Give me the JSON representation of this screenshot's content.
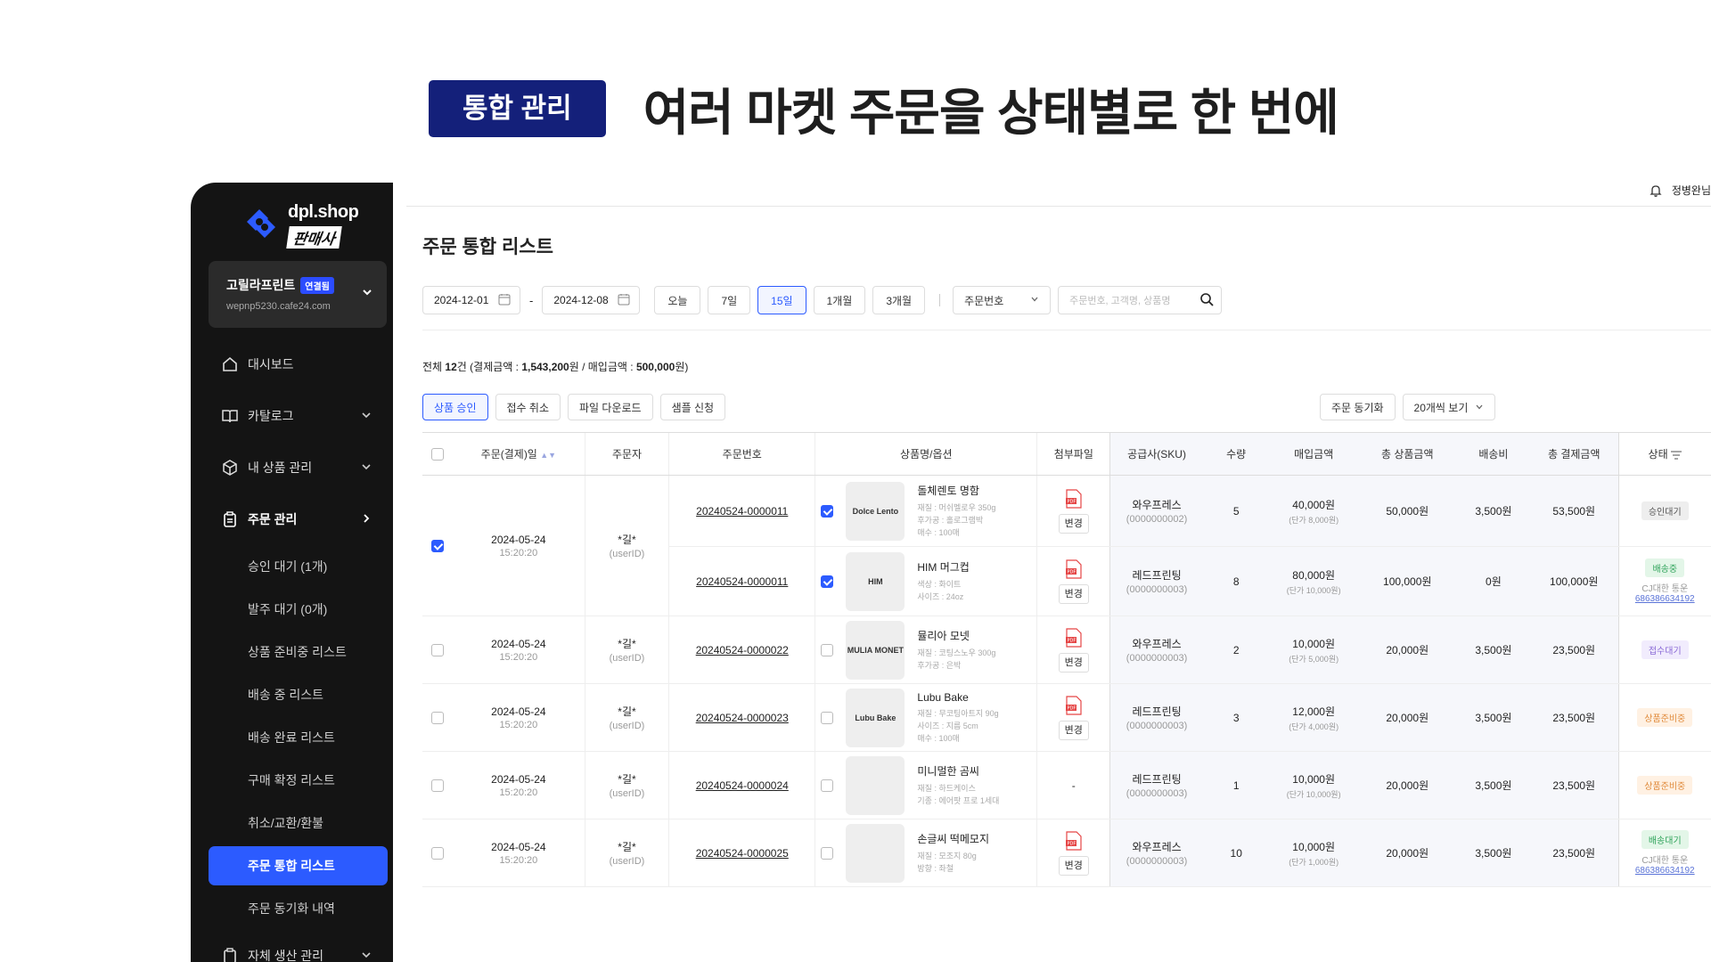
{
  "hero": {
    "badge": "통합 관리",
    "title": "여러 마켓 주문을 상태별로 한 번에"
  },
  "brand": {
    "name": "dpl.shop",
    "sub": "판매사"
  },
  "account": {
    "name": "고릴라프린트",
    "badge": "연결됨",
    "url": "wepnp5230.cafe24.com"
  },
  "nav": {
    "dashboard": "대시보드",
    "catalog": "카탈로그",
    "my_products": "내 상품 관리",
    "orders": "주문 관리",
    "sub": [
      "승인 대기 (1개)",
      "발주 대기 (0개)",
      "상품 준비중 리스트",
      "배송 중 리스트",
      "배송 완료 리스트",
      "구매 확정 리스트",
      "취소/교환/환불",
      "주문 통합 리스트",
      "주문 동기화 내역"
    ],
    "self_production": "자체 생산 관리"
  },
  "topbar": {
    "user": "정병완님"
  },
  "page": {
    "title": "주문 통합 리스트"
  },
  "filters": {
    "start_date": "2024-12-01",
    "end_date": "2024-12-08",
    "dash": "-",
    "periods": [
      "오늘",
      "7일",
      "15일",
      "1개월",
      "3개월"
    ],
    "selected_period": "15일",
    "search_type": "주문번호",
    "search_placeholder": "주문번호, 고객명, 상품명"
  },
  "summary": {
    "prefix": "전체 ",
    "count": "12",
    "count_unit": "건 (결제금액 : ",
    "payment": "1,543,200",
    "mid": "원 / 매입금액 : ",
    "purchase": "500,000",
    "suffix": "원)"
  },
  "actions": {
    "approve": "상품 승인",
    "cancel": "접수 취소",
    "download": "파일 다운로드",
    "sample": "샘플 신청",
    "sync": "주문 동기화",
    "per_page": "20개씩 보기"
  },
  "columns": {
    "date": "주문(결제)일",
    "orderer": "주문자",
    "order_no": "주문번호",
    "product": "상품명/옵션",
    "attachment": "첨부파일",
    "supplier": "공급사(SKU)",
    "qty": "수량",
    "purchase": "매입금액",
    "total_product": "총 상품금액",
    "shipping": "배송비",
    "total_payment": "총 결제금액",
    "status": "상태"
  },
  "rows": [
    {
      "date": "2024-05-24",
      "time": "15:20:20",
      "orderer": "*길*",
      "orderer_id": "(userID)",
      "checked": true,
      "items": [
        {
          "order_no": "20240524-0000011",
          "checked": true,
          "name": "돌체렌토 명함",
          "thumb": "Dolce Lento",
          "details": [
            "재질 : 머쉬멜로우 350g",
            "후가공 : 홀로그램박",
            "매수 : 100매"
          ],
          "attachment": "pdf",
          "change": "변경",
          "supplier": "와우프레스",
          "sku": "(0000000002)",
          "qty": "5",
          "purchase": "40,000원",
          "unit": "(단가 8,000원)",
          "total": "50,000원",
          "ship": "3,500원",
          "pay": "53,500원",
          "status": "승인대기",
          "status_color": "gray",
          "courier": "",
          "tracking": ""
        },
        {
          "order_no": "20240524-0000011",
          "checked": true,
          "name": "HIM 머그컵",
          "thumb": "HIM",
          "details": [
            "색상 : 화이트",
            "사이즈 : 24oz"
          ],
          "attachment": "pdf",
          "change": "변경",
          "supplier": "레드프린팅",
          "sku": "(0000000003)",
          "qty": "8",
          "purchase": "80,000원",
          "unit": "(단가 10,000원)",
          "total": "100,000원",
          "ship": "0원",
          "pay": "100,000원",
          "status": "배송중",
          "status_color": "green",
          "courier": "CJ대한 통운",
          "tracking": "686386634192"
        }
      ]
    },
    {
      "date": "2024-05-24",
      "time": "15:20:20",
      "orderer": "*길*",
      "orderer_id": "(userID)",
      "checked": false,
      "items": [
        {
          "order_no": "20240524-0000022",
          "checked": false,
          "name": "뮬리아 모넷",
          "thumb": "MULIA MONET",
          "details": [
            "재질 : 코팅스노우 300g",
            "후가공 : 은박"
          ],
          "attachment": "pdf",
          "change": "변경",
          "supplier": "와우프레스",
          "sku": "(0000000003)",
          "qty": "2",
          "purchase": "10,000원",
          "unit": "(단가 5,000원)",
          "total": "20,000원",
          "ship": "3,500원",
          "pay": "23,500원",
          "status": "접수대기",
          "status_color": "purple",
          "courier": "",
          "tracking": ""
        }
      ]
    },
    {
      "date": "2024-05-24",
      "time": "15:20:20",
      "orderer": "*길*",
      "orderer_id": "(userID)",
      "checked": false,
      "items": [
        {
          "order_no": "20240524-0000023",
          "checked": false,
          "name": "Lubu Bake",
          "thumb": "Lubu Bake",
          "details": [
            "재질 : 무코팅아트지 90g",
            "사이즈 : 지름 5cm",
            "매수 : 100매"
          ],
          "attachment": "pdf",
          "change": "변경",
          "supplier": "레드프린팅",
          "sku": "(0000000003)",
          "qty": "3",
          "purchase": "12,000원",
          "unit": "(단가 4,000원)",
          "total": "20,000원",
          "ship": "3,500원",
          "pay": "23,500원",
          "status": "상품준비중",
          "status_color": "orange",
          "courier": "",
          "tracking": ""
        }
      ]
    },
    {
      "date": "2024-05-24",
      "time": "15:20:20",
      "orderer": "*길*",
      "orderer_id": "(userID)",
      "checked": false,
      "items": [
        {
          "order_no": "20240524-0000024",
          "checked": false,
          "name": "미니멀한 곰씨",
          "thumb": "",
          "details": [
            "재질 : 하드케이스",
            "기종 : 에어팟 프로 1세대"
          ],
          "attachment": "-",
          "change": "",
          "supplier": "레드프린팅",
          "sku": "(0000000003)",
          "qty": "1",
          "purchase": "10,000원",
          "unit": "(단가 10,000원)",
          "total": "20,000원",
          "ship": "3,500원",
          "pay": "23,500원",
          "status": "상품준비중",
          "status_color": "orange",
          "courier": "",
          "tracking": ""
        }
      ]
    },
    {
      "date": "2024-05-24",
      "time": "15:20:20",
      "orderer": "*길*",
      "orderer_id": "(userID)",
      "checked": false,
      "items": [
        {
          "order_no": "20240524-0000025",
          "checked": false,
          "name": "손글씨 떡메모지",
          "thumb": "",
          "details": [
            "재질 : 모조지 80g",
            "방향 : 좌철"
          ],
          "attachment": "pdf",
          "change": "변경",
          "supplier": "와우프레스",
          "sku": "(0000000003)",
          "qty": "10",
          "purchase": "10,000원",
          "unit": "(단가 1,000원)",
          "total": "20,000원",
          "ship": "3,500원",
          "pay": "23,500원",
          "status": "배송대기",
          "status_color": "green",
          "courier": "CJ대한 통운",
          "tracking": "686386634192"
        }
      ]
    }
  ]
}
